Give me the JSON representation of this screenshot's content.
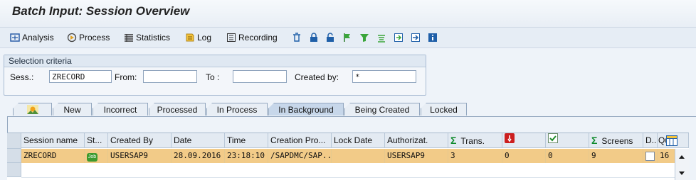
{
  "window": {
    "title": "Batch Input: Session Overview"
  },
  "toolbar": {
    "analysis": "Analysis",
    "process": "Process",
    "statistics": "Statistics",
    "log": "Log",
    "recording": "Recording",
    "icons": [
      "delete-icon",
      "lock-icon",
      "unlock-icon",
      "flag-icon",
      "filter-icon",
      "sort-icon",
      "export-icon",
      "export-local-icon",
      "info-icon"
    ]
  },
  "selection": {
    "heading": "Selection criteria",
    "sess_label": "Sess.:",
    "sess_value": "ZRECORD",
    "from_label": "From:",
    "from_value": "",
    "to_label": "To :",
    "to_value": "",
    "created_by_label": "Created by:",
    "created_by_value": "*"
  },
  "tabs": [
    "New",
    "Incorrect",
    "Processed",
    "In Process",
    "In Background",
    "Being Created",
    "Locked"
  ],
  "active_tab": "In Background",
  "table": {
    "columns": [
      "Session name",
      "St...",
      "Created By",
      "Date",
      "Time",
      "Creation Pro...",
      "Lock Date",
      "Authorizat.",
      "Trans.",
      "",
      "",
      "Screens",
      "D..",
      "Qu"
    ],
    "rows": [
      [
        "ZRECORD",
        "Job",
        "USERSAP9",
        "28.09.2016",
        "23:18:10",
        "/SAPDMC/SAP...",
        "",
        "USERSAP9",
        "3",
        "0",
        "0",
        "9",
        "",
        "16"
      ]
    ]
  },
  "colors": {
    "selected_row": "#f2cb88",
    "header": "#e3eaf2",
    "sigma": "#0e8a2c"
  }
}
